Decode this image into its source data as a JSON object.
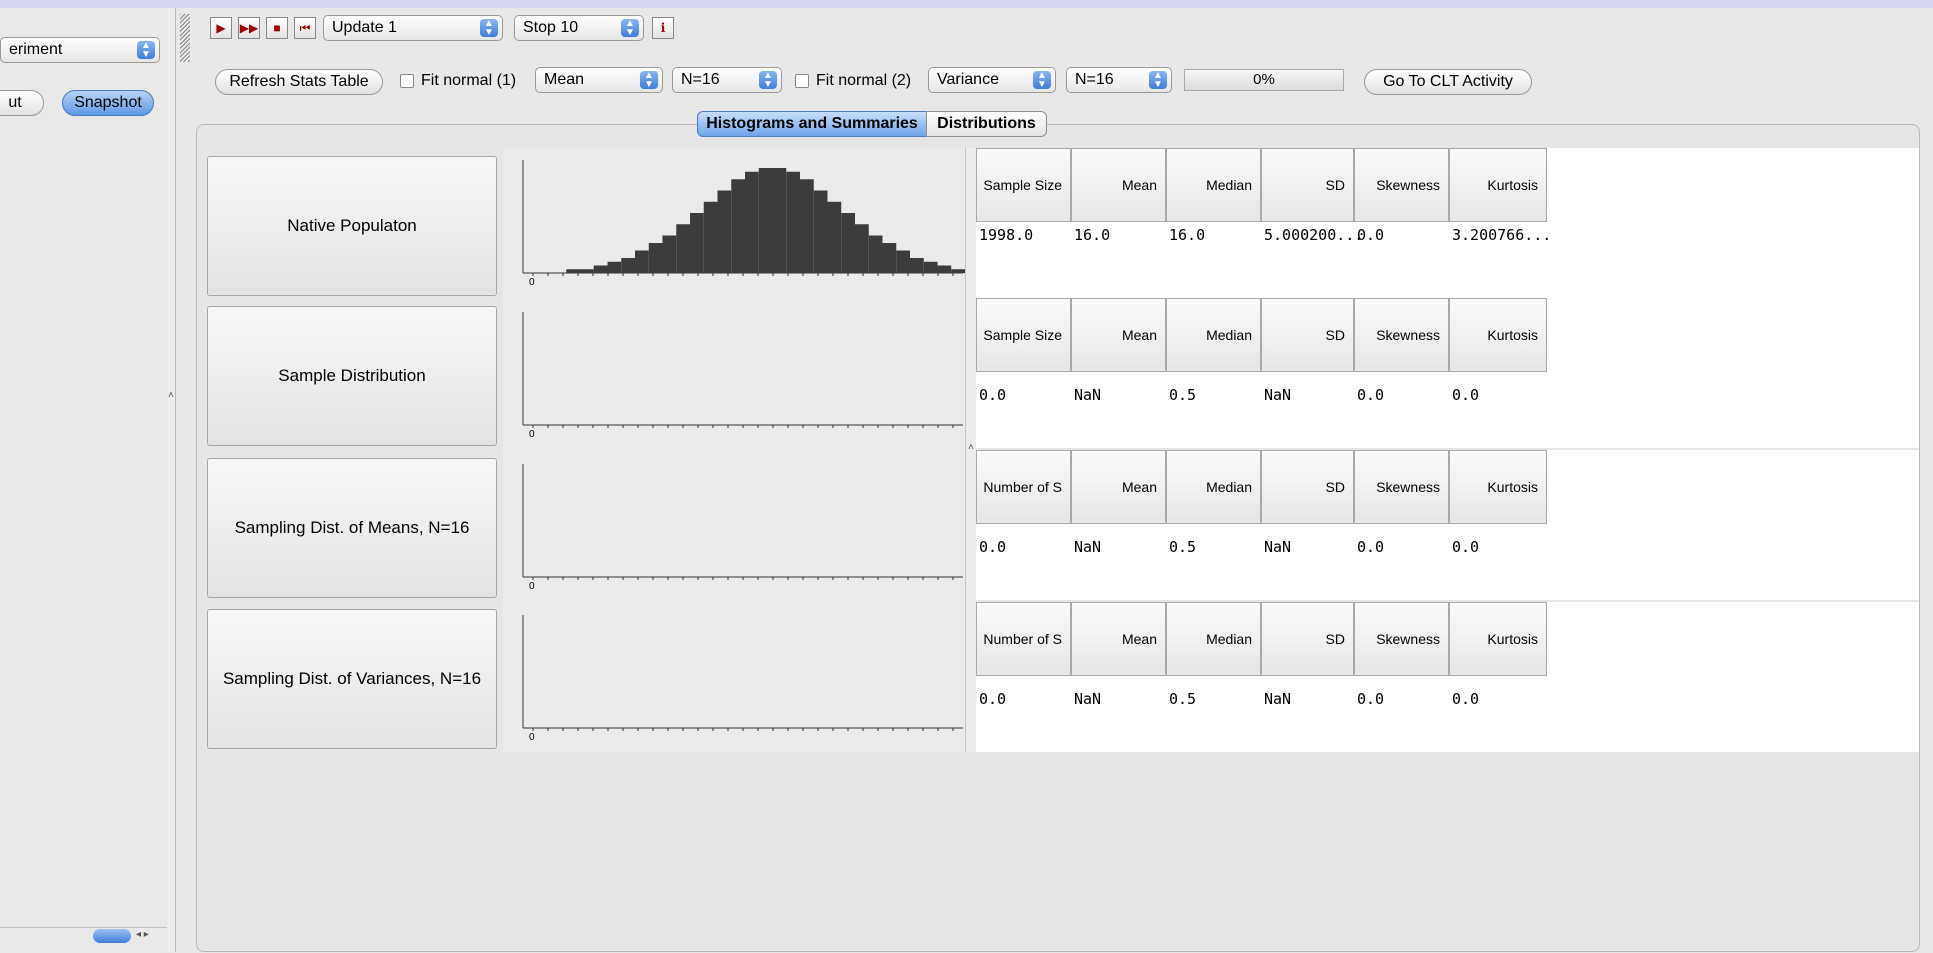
{
  "left_panel": {
    "experiment_select": "eriment",
    "about_button": "ut",
    "snapshot_button": "Snapshot"
  },
  "toolbar": {
    "update_select": "Update 1",
    "stop_select": "Stop 10",
    "info_label": "i"
  },
  "controls": {
    "refresh_button": "Refresh Stats Table",
    "fit_normal_1": "Fit normal (1)",
    "stat1_select": "Mean",
    "n1_select": "N=16",
    "fit_normal_2": "Fit normal (2)",
    "stat2_select": "Variance",
    "n2_select": "N=16",
    "progress_text": "0%",
    "progress_value": 0,
    "clt_button": "Go To CLT Activity"
  },
  "tabs": [
    {
      "label": "Histograms and Summaries",
      "active": true
    },
    {
      "label": "Distributions",
      "active": false
    }
  ],
  "rows": [
    {
      "button": "Native Populaton",
      "headers": [
        "Sample Size",
        "Mean",
        "Median",
        "SD",
        "Skewness",
        "Kurtosis"
      ],
      "values": [
        "1998.0",
        "16.0",
        "16.0",
        "5.000200...",
        "0.0",
        "3.200766..."
      ]
    },
    {
      "button": "Sample Distribution",
      "headers": [
        "Sample Size",
        "Mean",
        "Median",
        "SD",
        "Skewness",
        "Kurtosis"
      ],
      "values": [
        "0.0",
        "NaN",
        "0.5",
        "NaN",
        "0.0",
        "0.0"
      ]
    },
    {
      "button": "Sampling Dist. of  Means, N=16",
      "headers": [
        "Number of S",
        "Mean",
        "Median",
        "SD",
        "Skewness",
        "Kurtosis"
      ],
      "values": [
        "0.0",
        "NaN",
        "0.5",
        "NaN",
        "0.0",
        "0.0"
      ]
    },
    {
      "button": "Sampling Dist. of  Variances, N=16",
      "headers": [
        "Number of S",
        "Mean",
        "Median",
        "SD",
        "Skewness",
        "Kurtosis"
      ],
      "values": [
        "0.0",
        "NaN",
        "0.5",
        "NaN",
        "0.0",
        "0.0"
      ]
    }
  ],
  "chart_data": {
    "type": "bar",
    "values": [
      0,
      0,
      0,
      1,
      1,
      2,
      3,
      4,
      6,
      8,
      10,
      13,
      16,
      19,
      22,
      25,
      27,
      28,
      28,
      27,
      25,
      22,
      19,
      16,
      13,
      10,
      8,
      6,
      4,
      3,
      2,
      1
    ],
    "xlabel": "0"
  },
  "axis_zero_label": "0",
  "colors": {
    "bar": "#3c3c3c",
    "accent": "#5f98e6"
  }
}
